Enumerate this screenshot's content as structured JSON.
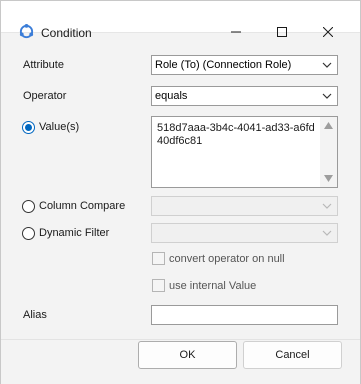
{
  "window": {
    "title": "Condition",
    "accent_color": "#0067c0"
  },
  "fields": {
    "attribute_label": "Attribute",
    "attribute_value": "Role (To) (Connection Role)",
    "operator_label": "Operator",
    "operator_value": "equals",
    "values_label": "Value(s)",
    "values_text": "518d7aaa-3b4c-4041-ad33-a6fd40df6c81",
    "column_compare_label": "Column Compare",
    "column_compare_value": "",
    "dynamic_filter_label": "Dynamic Filter",
    "dynamic_filter_value": "",
    "convert_operator_label": "convert operator on null",
    "use_internal_label": "use internal Value",
    "alias_label": "Alias",
    "alias_value": ""
  },
  "buttons": {
    "ok": "OK",
    "cancel": "Cancel"
  },
  "icons": {
    "app": "condition-app-icon",
    "minimize": "minimize-icon",
    "maximize": "maximize-icon",
    "close": "close-icon",
    "dropdown": "chevron-down-icon"
  }
}
